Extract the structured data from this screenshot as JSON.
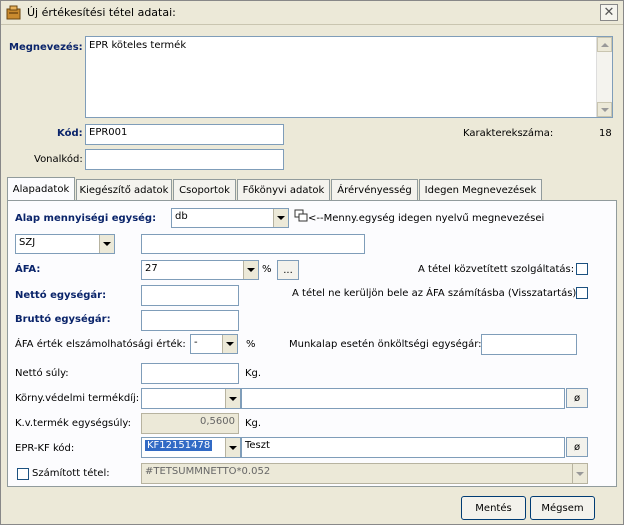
{
  "window": {
    "title": "Új értékesítési tétel adatai:"
  },
  "header": {
    "megnevezes_label": "Megnevezés:",
    "megnevezes_value": "EPR köteles termék",
    "kod_label": "Kód:",
    "kod_value": "EPR001",
    "karakterszam_label": "Karakterekszáma:",
    "karakterszam_value": "18",
    "vonalkod_label": "Vonalkód:",
    "vonalkod_value": ""
  },
  "tabs": [
    {
      "label": "Alapadatok"
    },
    {
      "label": "Kiegészítő adatok"
    },
    {
      "label": "Csoportok"
    },
    {
      "label": "Főkönyvi adatok"
    },
    {
      "label": "Árérvényesség"
    },
    {
      "label": "Idegen Megnevezések"
    }
  ],
  "alap": {
    "me_label": "Alap mennyiségi egység:",
    "me_value": "db",
    "me_hint": "<--Menny.egység idegen nyelvű megnevezései",
    "szj_value": "SZJ",
    "szj_text": "",
    "afa_label": "ÁFA:",
    "afa_value": "27",
    "afa_unit": "%",
    "afa_btn": "...",
    "kozvetitett_label": "A tétel  közvetített szolgáltatás:",
    "netto_label": "Nettó egységár:",
    "netto_value": "",
    "visszatartas_label": "A tétel  ne kerüljön bele az ÁFA számításba (Visszatartás):",
    "brutto_label": "Bruttó egységár:",
    "brutto_value": "",
    "afa_elsz_label": "ÁFA érték elszámolhatósági érték:",
    "afa_elsz_value": "-",
    "afa_elsz_unit": "%",
    "munkalap_label": "Munkalap esetén önköltségi egységár:",
    "munkalap_value": "",
    "netto_suly_label": "Nettó súly:",
    "netto_suly_value": "",
    "netto_suly_unit": "Kg.",
    "kornyv_label": "Körny.védelmi termékdíj:",
    "kornyv_value": "",
    "kornyv_text": "",
    "kornyv_btn": "ø",
    "kvsuly_label": "K.v.termék egységsúly:",
    "kvsuly_value": "0,5600",
    "kvsuly_unit": "Kg.",
    "eprkf_label": "EPR-KF kód:",
    "eprkf_value": "KF12151478",
    "eprkf_text": "Teszt",
    "eprkf_btn": "ø",
    "szamitott_label": "Számított tétel:",
    "szamitott_value": "#TETSUMMNETTO*0.052"
  },
  "footer": {
    "save_label": "Mentés",
    "cancel_label": "Mégsem"
  }
}
